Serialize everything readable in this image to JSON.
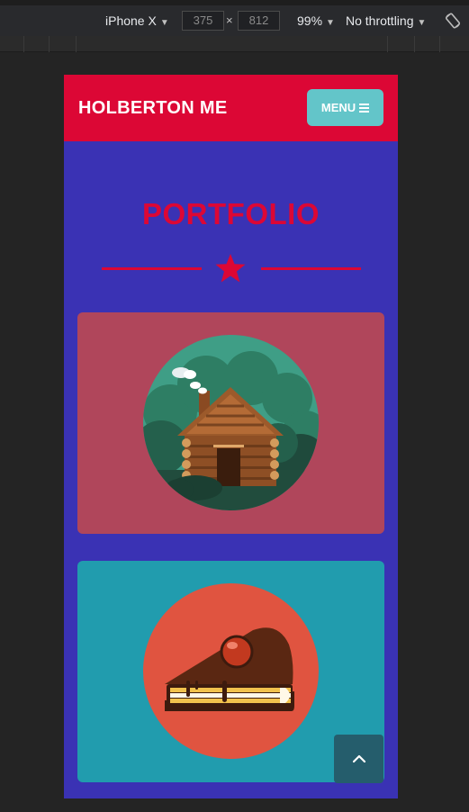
{
  "devtools": {
    "device": "iPhone X",
    "width": "375",
    "height": "812",
    "zoom": "99%",
    "throttling": "No throttling",
    "times_symbol": "×"
  },
  "header": {
    "brand": "HOLBERTON ME",
    "menu_label": "MENU"
  },
  "portfolio": {
    "title": "PORTFOLIO",
    "items": [
      {
        "icon": "cabin-icon",
        "background": "#b0465b"
      },
      {
        "icon": "cake-icon",
        "background": "#219cae"
      }
    ]
  },
  "colors": {
    "accent": "#dc0735",
    "page_bg": "#3a32b4",
    "menu_button": "#63c5c9",
    "back_to_top": "#255d6c"
  },
  "icons": {
    "divider": "star-icon",
    "back_to_top": "chevron-up-icon",
    "rotate": "rotate-icon"
  }
}
